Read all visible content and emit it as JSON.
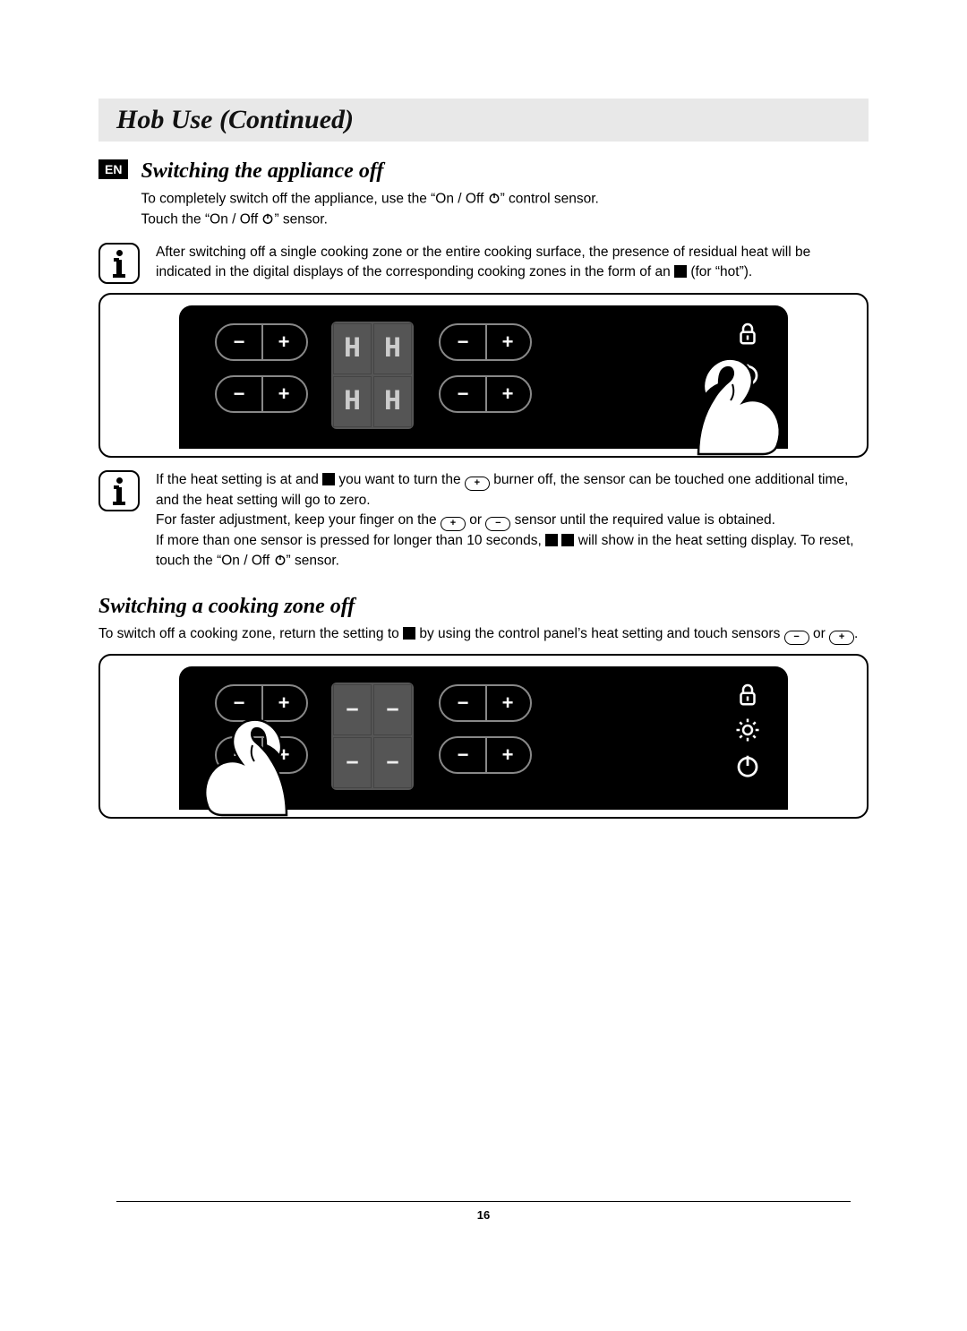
{
  "header": {
    "title": "Hob Use (Continued)"
  },
  "lang": "EN",
  "section1": {
    "title": "Switching the appliance off",
    "p1a": "To completely switch off the appliance, use the “On / Off ",
    "p1b": "” control sensor.",
    "p2a": "Touch the “On / Off ",
    "p2b": "” sensor.",
    "note1a": "After switching off a single cooking zone or the entire cooking surface, the presence of residual heat will be indicated in the digital displays of the corresponding cooking zones in the form of an ",
    "note1b": " (for “hot”)."
  },
  "note2": {
    "t1a": "If the heat setting is at and ",
    "t1b": " you want to turn the ",
    "t1c": " burner off, the sensor can be touched one additional time, and the heat setting will go to zero.",
    "t2a": "For faster adjustment, keep your finger on the ",
    "t2b": " or ",
    "t2c": " sensor until the required value is obtained.",
    "t3a": "If more than one sensor is pressed for longer than 10 seconds, ",
    "t3b": " will show in the heat setting display. To reset, touch the “On / Off ",
    "t3c": "” sensor."
  },
  "section2": {
    "title": "Switching a cooking zone off",
    "p1a": "To switch off a cooking zone, return the setting to ",
    "p1b": " by using the control panel’s heat setting and touch sensors ",
    "p1c": " or ",
    "p1d": "."
  },
  "figure": {
    "display_H": "H",
    "display_dash": "–",
    "minus": "−",
    "plus": "+"
  },
  "pageNumber": "16"
}
